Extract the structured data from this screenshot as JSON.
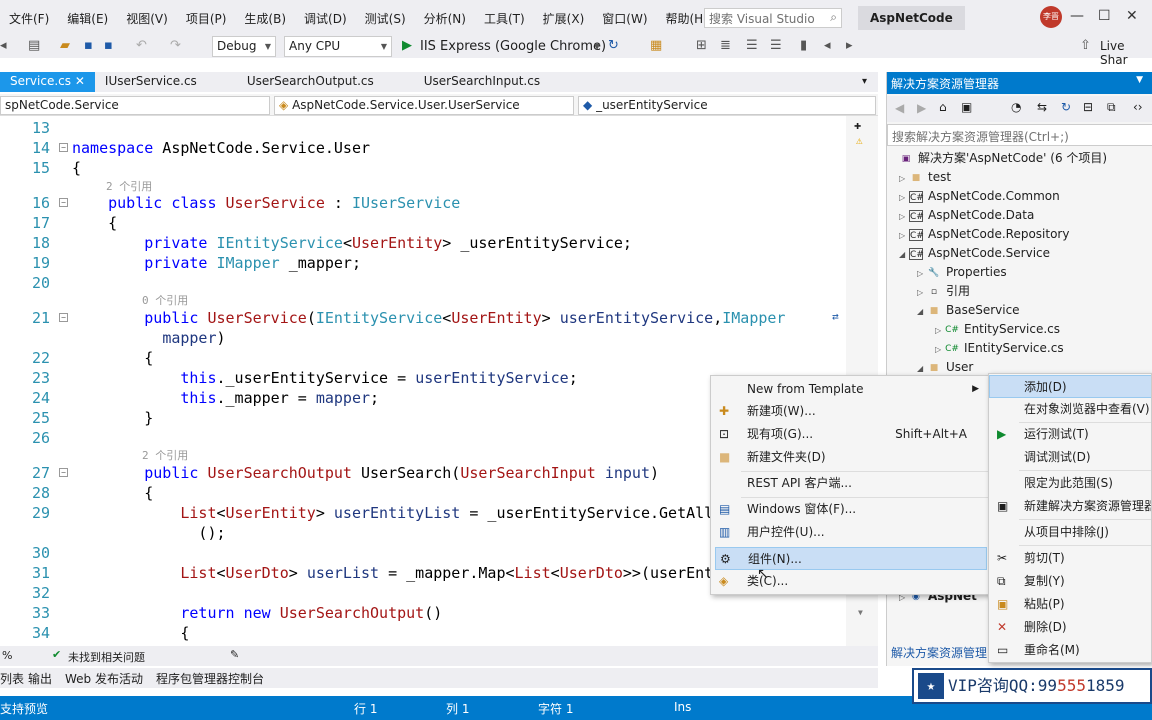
{
  "menubar": {
    "items": [
      "文件(F)",
      "编辑(E)",
      "视图(V)",
      "项目(P)",
      "生成(B)",
      "调试(D)",
      "测试(S)",
      "分析(N)",
      "工具(T)",
      "扩展(X)",
      "窗口(W)",
      "帮助(H)"
    ],
    "search_placeholder": "搜索 Visual Studio",
    "project_name": "AspNetCode",
    "avatar_text": "李晋",
    "live_share": "Live Shar"
  },
  "toolbar": {
    "config": "Debug",
    "platform": "Any CPU",
    "run_target": "IIS Express (Google Chrome)"
  },
  "tabs": [
    {
      "label": "Service.cs",
      "active": true
    },
    {
      "label": "IUserService.cs",
      "active": false
    },
    {
      "label": "UserSearchOutput.cs",
      "active": false
    },
    {
      "label": "UserSearchInput.cs",
      "active": false
    }
  ],
  "navbar": {
    "project": "spNetCode.Service",
    "type": "AspNetCode.Service.User.UserService",
    "member": "_userEntityService"
  },
  "code": {
    "l13": "13",
    "l14": "14",
    "l15": "15",
    "l16": "16",
    "l17": "17",
    "l18": "18",
    "l19": "19",
    "l20": "20",
    "l21": "21",
    "l22": "22",
    "l23": "23",
    "l24": "24",
    "l25": "25",
    "l26": "26",
    "l27": "27",
    "l28": "28",
    "l29": "29",
    "l30": "30",
    "l31": "31",
    "l32": "32",
    "l33": "33",
    "l34": "34",
    "lens_2ref_a": "2 个引用",
    "lens_0ref": "0 个引用",
    "lens_2ref_b": "2 个引用"
  },
  "errbar": {
    "text": "未找到相关问题",
    "zoom": "%"
  },
  "bottom_tabs": [
    "列表",
    "输出",
    "Web 发布活动",
    "程序包管理器控制台"
  ],
  "statusbar": {
    "left": "支持预览",
    "row": "行 1",
    "col": "列 1",
    "char": "字符 1",
    "mode": "Ins"
  },
  "solution_explorer": {
    "title": "解决方案资源管理器",
    "search_placeholder": "搜索解决方案资源管理器(Ctrl+;)",
    "footer": "解决方案资源管理",
    "tree": [
      {
        "label": "解决方案'AspNetCode' (6 个项目)",
        "icon": "solution-icon"
      },
      {
        "label": "test",
        "icon": "folder-icon"
      },
      {
        "label": "AspNetCode.Common",
        "icon": "csproj-icon"
      },
      {
        "label": "AspNetCode.Data",
        "icon": "csproj-icon"
      },
      {
        "label": "AspNetCode.Repository",
        "icon": "csproj-icon"
      },
      {
        "label": "AspNetCode.Service",
        "icon": "csproj-icon"
      },
      {
        "label": "Properties",
        "icon": "wrench-icon"
      },
      {
        "label": "引用",
        "icon": "references-icon"
      },
      {
        "label": "BaseService",
        "icon": "folder-icon"
      },
      {
        "label": "EntityService.cs",
        "icon": "csfile-icon"
      },
      {
        "label": "IEntityService.cs",
        "icon": "csfile-icon"
      },
      {
        "label": "User",
        "icon": "folder-icon"
      },
      {
        "label": "AspNet",
        "icon": "globe-icon"
      }
    ]
  },
  "context_menu_add": [
    {
      "label": "New from Template",
      "shortcut": "",
      "icon": "",
      "arrow": "▸"
    },
    {
      "label": "新建项(W)...",
      "shortcut": "",
      "icon": "new-item-icon"
    },
    {
      "label": "现有项(G)...",
      "shortcut": "Shift+Alt+A",
      "icon": "existing-item-icon"
    },
    {
      "label": "新建文件夹(D)",
      "shortcut": "",
      "icon": "new-folder-icon"
    },
    {
      "label": "REST API 客户端...",
      "shortcut": "",
      "icon": ""
    },
    {
      "label": "Windows 窗体(F)...",
      "shortcut": "",
      "icon": "windows-form-icon"
    },
    {
      "label": "用户控件(U)...",
      "shortcut": "",
      "icon": "user-control-icon"
    },
    {
      "label": "组件(N)...",
      "shortcut": "",
      "icon": "component-icon"
    },
    {
      "label": "类(C)...",
      "shortcut": "",
      "icon": "class-icon"
    }
  ],
  "context_menu_main": [
    {
      "label": "添加(D)",
      "icon": ""
    },
    {
      "label": "在对象浏览器中查看(V)",
      "icon": ""
    },
    {
      "label": "运行测试(T)",
      "icon": "play-icon"
    },
    {
      "label": "调试测试(D)",
      "icon": ""
    },
    {
      "label": "限定为此范围(S)",
      "icon": ""
    },
    {
      "label": "新建解决方案资源管理器",
      "icon": "new-view-icon"
    },
    {
      "label": "从项目中排除(J)",
      "icon": ""
    },
    {
      "label": "剪切(T)",
      "icon": "cut-icon"
    },
    {
      "label": "复制(Y)",
      "icon": "copy-icon"
    },
    {
      "label": "粘贴(P)",
      "icon": "paste-icon"
    },
    {
      "label": "删除(D)",
      "icon": "delete-icon"
    },
    {
      "label": "重命名(M)",
      "icon": "rename-icon"
    }
  ],
  "vip": {
    "text_a": "VIP咨询QQ:99",
    "text_b": "555",
    "text_c": "1859"
  },
  "colors": {
    "accent": "#007acc",
    "tab_active": "#1c97ea",
    "highlight": "#c9def5"
  }
}
